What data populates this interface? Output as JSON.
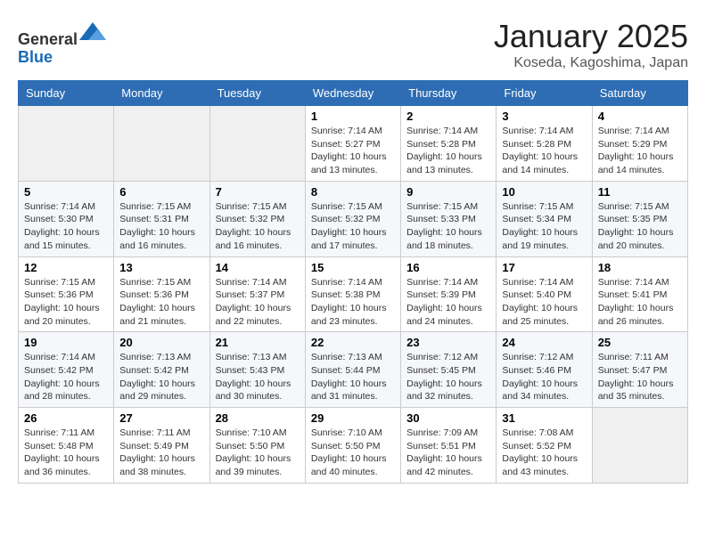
{
  "header": {
    "logo_line1": "General",
    "logo_line2": "Blue",
    "title": "January 2025",
    "subtitle": "Koseda, Kagoshima, Japan"
  },
  "weekdays": [
    "Sunday",
    "Monday",
    "Tuesday",
    "Wednesday",
    "Thursday",
    "Friday",
    "Saturday"
  ],
  "weeks": [
    [
      {
        "day": "",
        "sunrise": "",
        "sunset": "",
        "daylight": "",
        "empty": true
      },
      {
        "day": "",
        "sunrise": "",
        "sunset": "",
        "daylight": "",
        "empty": true
      },
      {
        "day": "",
        "sunrise": "",
        "sunset": "",
        "daylight": "",
        "empty": true
      },
      {
        "day": "1",
        "sunrise": "Sunrise: 7:14 AM",
        "sunset": "Sunset: 5:27 PM",
        "daylight": "Daylight: 10 hours and 13 minutes."
      },
      {
        "day": "2",
        "sunrise": "Sunrise: 7:14 AM",
        "sunset": "Sunset: 5:28 PM",
        "daylight": "Daylight: 10 hours and 13 minutes."
      },
      {
        "day": "3",
        "sunrise": "Sunrise: 7:14 AM",
        "sunset": "Sunset: 5:28 PM",
        "daylight": "Daylight: 10 hours and 14 minutes."
      },
      {
        "day": "4",
        "sunrise": "Sunrise: 7:14 AM",
        "sunset": "Sunset: 5:29 PM",
        "daylight": "Daylight: 10 hours and 14 minutes."
      }
    ],
    [
      {
        "day": "5",
        "sunrise": "Sunrise: 7:14 AM",
        "sunset": "Sunset: 5:30 PM",
        "daylight": "Daylight: 10 hours and 15 minutes."
      },
      {
        "day": "6",
        "sunrise": "Sunrise: 7:15 AM",
        "sunset": "Sunset: 5:31 PM",
        "daylight": "Daylight: 10 hours and 16 minutes."
      },
      {
        "day": "7",
        "sunrise": "Sunrise: 7:15 AM",
        "sunset": "Sunset: 5:32 PM",
        "daylight": "Daylight: 10 hours and 16 minutes."
      },
      {
        "day": "8",
        "sunrise": "Sunrise: 7:15 AM",
        "sunset": "Sunset: 5:32 PM",
        "daylight": "Daylight: 10 hours and 17 minutes."
      },
      {
        "day": "9",
        "sunrise": "Sunrise: 7:15 AM",
        "sunset": "Sunset: 5:33 PM",
        "daylight": "Daylight: 10 hours and 18 minutes."
      },
      {
        "day": "10",
        "sunrise": "Sunrise: 7:15 AM",
        "sunset": "Sunset: 5:34 PM",
        "daylight": "Daylight: 10 hours and 19 minutes."
      },
      {
        "day": "11",
        "sunrise": "Sunrise: 7:15 AM",
        "sunset": "Sunset: 5:35 PM",
        "daylight": "Daylight: 10 hours and 20 minutes."
      }
    ],
    [
      {
        "day": "12",
        "sunrise": "Sunrise: 7:15 AM",
        "sunset": "Sunset: 5:36 PM",
        "daylight": "Daylight: 10 hours and 20 minutes."
      },
      {
        "day": "13",
        "sunrise": "Sunrise: 7:15 AM",
        "sunset": "Sunset: 5:36 PM",
        "daylight": "Daylight: 10 hours and 21 minutes."
      },
      {
        "day": "14",
        "sunrise": "Sunrise: 7:14 AM",
        "sunset": "Sunset: 5:37 PM",
        "daylight": "Daylight: 10 hours and 22 minutes."
      },
      {
        "day": "15",
        "sunrise": "Sunrise: 7:14 AM",
        "sunset": "Sunset: 5:38 PM",
        "daylight": "Daylight: 10 hours and 23 minutes."
      },
      {
        "day": "16",
        "sunrise": "Sunrise: 7:14 AM",
        "sunset": "Sunset: 5:39 PM",
        "daylight": "Daylight: 10 hours and 24 minutes."
      },
      {
        "day": "17",
        "sunrise": "Sunrise: 7:14 AM",
        "sunset": "Sunset: 5:40 PM",
        "daylight": "Daylight: 10 hours and 25 minutes."
      },
      {
        "day": "18",
        "sunrise": "Sunrise: 7:14 AM",
        "sunset": "Sunset: 5:41 PM",
        "daylight": "Daylight: 10 hours and 26 minutes."
      }
    ],
    [
      {
        "day": "19",
        "sunrise": "Sunrise: 7:14 AM",
        "sunset": "Sunset: 5:42 PM",
        "daylight": "Daylight: 10 hours and 28 minutes."
      },
      {
        "day": "20",
        "sunrise": "Sunrise: 7:13 AM",
        "sunset": "Sunset: 5:42 PM",
        "daylight": "Daylight: 10 hours and 29 minutes."
      },
      {
        "day": "21",
        "sunrise": "Sunrise: 7:13 AM",
        "sunset": "Sunset: 5:43 PM",
        "daylight": "Daylight: 10 hours and 30 minutes."
      },
      {
        "day": "22",
        "sunrise": "Sunrise: 7:13 AM",
        "sunset": "Sunset: 5:44 PM",
        "daylight": "Daylight: 10 hours and 31 minutes."
      },
      {
        "day": "23",
        "sunrise": "Sunrise: 7:12 AM",
        "sunset": "Sunset: 5:45 PM",
        "daylight": "Daylight: 10 hours and 32 minutes."
      },
      {
        "day": "24",
        "sunrise": "Sunrise: 7:12 AM",
        "sunset": "Sunset: 5:46 PM",
        "daylight": "Daylight: 10 hours and 34 minutes."
      },
      {
        "day": "25",
        "sunrise": "Sunrise: 7:11 AM",
        "sunset": "Sunset: 5:47 PM",
        "daylight": "Daylight: 10 hours and 35 minutes."
      }
    ],
    [
      {
        "day": "26",
        "sunrise": "Sunrise: 7:11 AM",
        "sunset": "Sunset: 5:48 PM",
        "daylight": "Daylight: 10 hours and 36 minutes."
      },
      {
        "day": "27",
        "sunrise": "Sunrise: 7:11 AM",
        "sunset": "Sunset: 5:49 PM",
        "daylight": "Daylight: 10 hours and 38 minutes."
      },
      {
        "day": "28",
        "sunrise": "Sunrise: 7:10 AM",
        "sunset": "Sunset: 5:50 PM",
        "daylight": "Daylight: 10 hours and 39 minutes."
      },
      {
        "day": "29",
        "sunrise": "Sunrise: 7:10 AM",
        "sunset": "Sunset: 5:50 PM",
        "daylight": "Daylight: 10 hours and 40 minutes."
      },
      {
        "day": "30",
        "sunrise": "Sunrise: 7:09 AM",
        "sunset": "Sunset: 5:51 PM",
        "daylight": "Daylight: 10 hours and 42 minutes."
      },
      {
        "day": "31",
        "sunrise": "Sunrise: 7:08 AM",
        "sunset": "Sunset: 5:52 PM",
        "daylight": "Daylight: 10 hours and 43 minutes."
      },
      {
        "day": "",
        "sunrise": "",
        "sunset": "",
        "daylight": "",
        "empty": true
      }
    ]
  ]
}
